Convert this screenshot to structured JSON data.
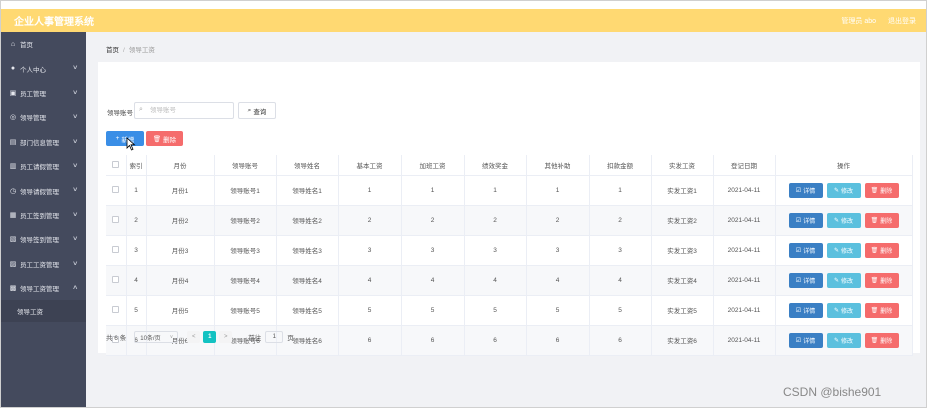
{
  "app": {
    "title": "企业人事管理系统",
    "user": "管理员 abo",
    "logout": "退出登录"
  },
  "sidebar": {
    "items": [
      {
        "label": "首页",
        "icon": "home-icon",
        "glyph": "⌂",
        "chev": ""
      },
      {
        "label": "个人中心",
        "icon": "user-icon",
        "glyph": "●",
        "chev": "∨"
      },
      {
        "label": "员工管理",
        "icon": "staff-icon",
        "glyph": "▣",
        "chev": "∨"
      },
      {
        "label": "领导管理",
        "icon": "leader-icon",
        "glyph": "◎",
        "chev": "∨"
      },
      {
        "label": "部门信息管理",
        "icon": "department-icon",
        "glyph": "▤",
        "chev": "∨"
      },
      {
        "label": "员工请假管理",
        "icon": "leave-icon",
        "glyph": "▥",
        "chev": "∨"
      },
      {
        "label": "领导请假管理",
        "icon": "leader-leave-icon",
        "glyph": "◷",
        "chev": "∨"
      },
      {
        "label": "员工签到管理",
        "icon": "checkin-icon",
        "glyph": "▦",
        "chev": "∨"
      },
      {
        "label": "领导签到管理",
        "icon": "leader-checkin-icon",
        "glyph": "▧",
        "chev": "∨"
      },
      {
        "label": "员工工资管理",
        "icon": "salary-icon",
        "glyph": "▨",
        "chev": "∨"
      },
      {
        "label": "领导工资管理",
        "icon": "leader-salary-icon",
        "glyph": "▩",
        "chev": "∧"
      }
    ],
    "sub_item": "领导工资"
  },
  "breadcrumb": {
    "home": "首页",
    "separator": "/",
    "current": "领导工资"
  },
  "search": {
    "label": "领导账号",
    "placeholder": "领导账号",
    "query_label": "查询"
  },
  "toolbar": {
    "add_label": "新增",
    "delete_label": "删除"
  },
  "table": {
    "headers": [
      "索引",
      "月份",
      "领导账号",
      "领导姓名",
      "基本工资",
      "加班工资",
      "绩效奖金",
      "其他补助",
      "扣款金额",
      "实发工资",
      "登记日期",
      "操作"
    ],
    "rows": [
      [
        "1",
        "月份1",
        "领导账号1",
        "领导姓名1",
        "1",
        "1",
        "1",
        "1",
        "1",
        "实发工资1",
        "2021-04-11"
      ],
      [
        "2",
        "月份2",
        "领导账号2",
        "领导姓名2",
        "2",
        "2",
        "2",
        "2",
        "2",
        "实发工资2",
        "2021-04-11"
      ],
      [
        "3",
        "月份3",
        "领导账号3",
        "领导姓名3",
        "3",
        "3",
        "3",
        "3",
        "3",
        "实发工资3",
        "2021-04-11"
      ],
      [
        "4",
        "月份4",
        "领导账号4",
        "领导姓名4",
        "4",
        "4",
        "4",
        "4",
        "4",
        "实发工资4",
        "2021-04-11"
      ],
      [
        "5",
        "月份5",
        "领导账号5",
        "领导姓名5",
        "5",
        "5",
        "5",
        "5",
        "5",
        "实发工资5",
        "2021-04-11"
      ],
      [
        "6",
        "月份6",
        "领导账号6",
        "领导姓名6",
        "6",
        "6",
        "6",
        "6",
        "6",
        "实发工资6",
        "2021-04-11"
      ]
    ],
    "row_actions": {
      "detail": "详情",
      "edit": "修改",
      "delete": "删除"
    }
  },
  "pagination": {
    "total": "共 6 条",
    "page_size": "10条/页",
    "current_page": "1",
    "prev": "<",
    "next": ">",
    "goto_label": "前往",
    "goto_value": "1",
    "page_suffix": "页"
  },
  "watermark": "CSDN @bishe901",
  "colors": {
    "topbar": "#ffd972",
    "sidebar": "#444a5d",
    "primary": "#3a8ee6",
    "danger": "#f56c6c",
    "info": "#5bc0de",
    "active_page": "#13c2c2"
  }
}
